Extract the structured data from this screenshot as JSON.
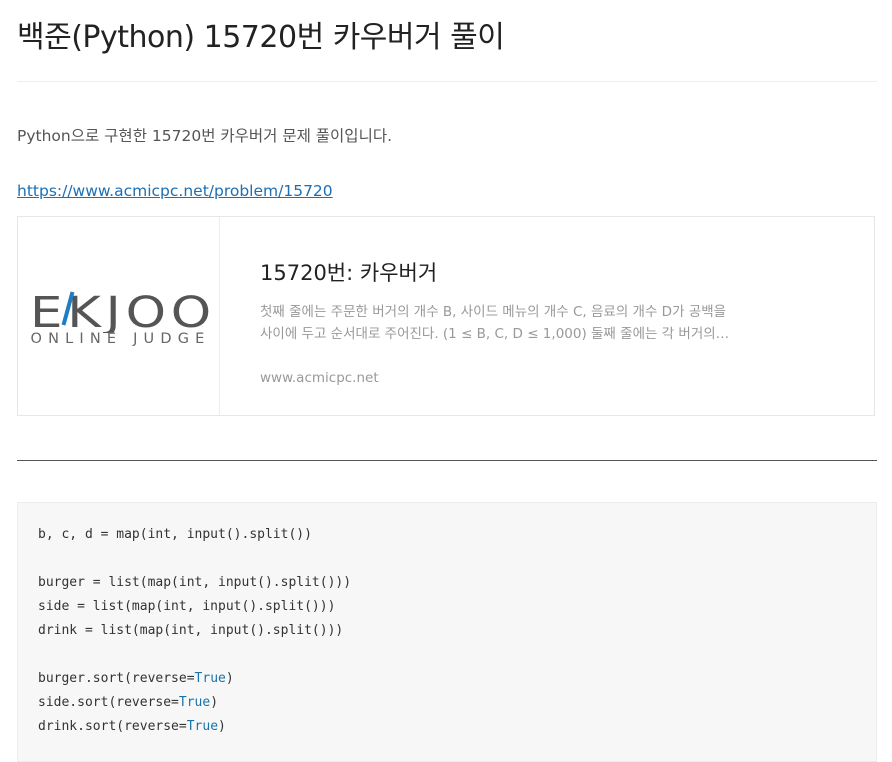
{
  "post": {
    "title": "백준(Python) 15720번 카우버거 풀이",
    "intro": "Python으로 구현한 15720번 카우버거 문제 풀이입니다.",
    "link": "https://www.acmicpc.net/problem/15720"
  },
  "og_card": {
    "logo_main": "EKJOO",
    "logo_sub": "ONLINE JUDGE",
    "title": "15720번: 카우버거",
    "description": "첫째 줄에는 주문한 버거의 개수 B, 사이드 메뉴의 개수 C, 음료의 개수 D가 공백을 사이에 두고 순서대로 주어진다. (1 ≤ B, C, D ≤ 1,000) 둘째 줄에는 각 버거의 가격이 주어진다.",
    "domain": "www.acmicpc.net"
  },
  "code": {
    "lines": [
      {
        "text": "b, c, d = map(int, input().split())"
      },
      {
        "text": ""
      },
      {
        "text": "burger = list(map(int, input().split()))"
      },
      {
        "text": "side = list(map(int, input().split()))"
      },
      {
        "text": "drink = list(map(int, input().split()))"
      },
      {
        "text": ""
      },
      {
        "pre": "burger.sort(reverse=",
        "kw": "True",
        "post": ")"
      },
      {
        "pre": "side.sort(reverse=",
        "kw": "True",
        "post": ")"
      },
      {
        "pre": "drink.sort(reverse=",
        "kw": "True",
        "post": ")"
      }
    ]
  },
  "colors": {
    "link": "#1a6fb5",
    "logo_blue": "#1f7dc4",
    "code_keyword": "#1a73a8",
    "code_background": "#f7f7f7"
  }
}
